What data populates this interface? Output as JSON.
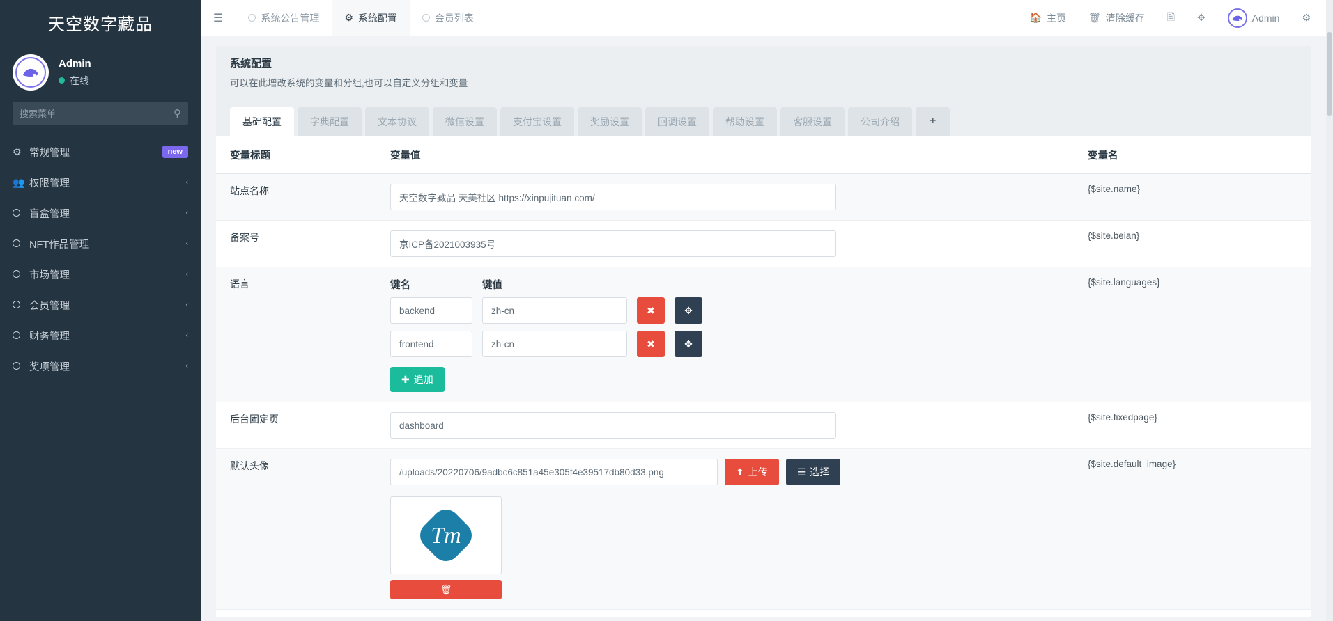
{
  "sidebar": {
    "brand": "天空数字藏品",
    "profile": {
      "name": "Admin",
      "status": "在线",
      "avatar_icon": "user-avatar-icon"
    },
    "search": {
      "placeholder": "搜索菜单",
      "icon": "search-icon"
    },
    "items": [
      {
        "label": "常规管理",
        "icon": "gears-icon",
        "badge": "new",
        "chevron": ""
      },
      {
        "label": "权限管理",
        "icon": "users-icon",
        "badge": "",
        "chevron": "‹"
      },
      {
        "label": "盲盒管理",
        "icon": "circle-icon",
        "badge": "",
        "chevron": "‹"
      },
      {
        "label": "NFT作品管理",
        "icon": "circle-icon",
        "badge": "",
        "chevron": "‹"
      },
      {
        "label": "市场管理",
        "icon": "circle-icon",
        "badge": "",
        "chevron": "‹"
      },
      {
        "label": "会员管理",
        "icon": "circle-icon",
        "badge": "",
        "chevron": "‹"
      },
      {
        "label": "财务管理",
        "icon": "circle-icon",
        "badge": "",
        "chevron": "‹"
      },
      {
        "label": "奖项管理",
        "icon": "circle-icon",
        "badge": "",
        "chevron": "‹"
      }
    ]
  },
  "navbar": {
    "burger_icon": "hamburger-menu-icon",
    "tabs": [
      {
        "label": "系统公告管理",
        "icon": "circle-icon",
        "active": false
      },
      {
        "label": "系统配置",
        "icon": "gear-icon",
        "active": true
      },
      {
        "label": "会员列表",
        "icon": "circle-icon",
        "active": false
      }
    ],
    "actions": [
      {
        "label": "主页",
        "icon": "home-icon"
      },
      {
        "label": "清除缓存",
        "icon": "trash-icon"
      },
      {
        "label": "",
        "icon": "language-icon"
      },
      {
        "label": "",
        "icon": "fullscreen-icon"
      }
    ],
    "user": {
      "label": "Admin",
      "icon": "user-avatar-icon"
    },
    "settings_icon": "gears-icon"
  },
  "panel": {
    "title": "系统配置",
    "subtitle": "可以在此增改系统的变量和分组,也可以自定义分组和变量",
    "tabs": [
      {
        "label": "基础配置",
        "active": true
      },
      {
        "label": "字典配置",
        "active": false
      },
      {
        "label": "文本协议",
        "active": false
      },
      {
        "label": "微信设置",
        "active": false
      },
      {
        "label": "支付宝设置",
        "active": false
      },
      {
        "label": "奖励设置",
        "active": false
      },
      {
        "label": "回调设置",
        "active": false
      },
      {
        "label": "帮助设置",
        "active": false
      },
      {
        "label": "客服设置",
        "active": false
      },
      {
        "label": "公司介绍",
        "active": false
      }
    ],
    "add_tab_label": "+",
    "columns": {
      "title": "变量标题",
      "value": "变量值",
      "name": "变量名"
    },
    "rows": {
      "site_name": {
        "label": "站点名称",
        "value": "天空数字藏品 天美社区 https://xinpujituan.com/",
        "var": "{$site.name}"
      },
      "beian": {
        "label": "备案号",
        "value": "京ICP备2021003935号",
        "var": "{$site.beian}"
      },
      "languages": {
        "label": "语言",
        "var": "{$site.languages}",
        "key_header": "键名",
        "value_header": "键值",
        "pairs": [
          {
            "key": "backend",
            "value": "zh-cn"
          },
          {
            "key": "frontend",
            "value": "zh-cn"
          }
        ],
        "add_label": "追加",
        "delete_icon": "close-x-icon",
        "move_icon": "move-arrows-icon"
      },
      "fixedpage": {
        "label": "后台固定页",
        "value": "dashboard",
        "var": "{$site.fixedpage}"
      },
      "default_image": {
        "label": "默认头像",
        "value": "/uploads/20220706/9adbc6c851a45e305f4e39517db80d33.png",
        "var": "{$site.default_image}",
        "upload_label": "上传",
        "upload_icon": "upload-icon",
        "select_label": "选择",
        "select_icon": "list-icon",
        "thumb_text": "Tm",
        "delete_icon": "trash-icon"
      }
    }
  },
  "colors": {
    "sidebar_bg": "#243441",
    "accent_teal": "#1abc9c",
    "danger_red": "#e74c3c",
    "dark_navy": "#2f4052",
    "badge_purple": "#7b68ee",
    "logo_teal": "#1b7fa8"
  }
}
